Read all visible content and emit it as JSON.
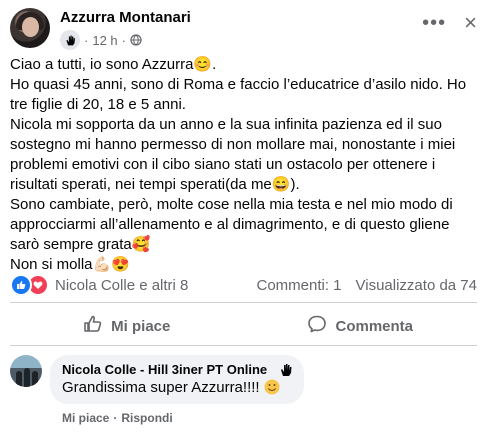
{
  "post": {
    "author": "Azzurra Montanari",
    "time": "12 h",
    "meta_separator": "·",
    "paragraphs": [
      "Ciao a tutti, io sono Azzurra😊.",
      "Ho quasi 45 anni, sono di Roma e faccio l’educatrice d’asilo nido. Ho tre figlie di 20, 18 e 5 anni.",
      "Nicola mi sopporta da un anno e la sua infinita pazienza ed il suo sostegno mi hanno permesso di non mollare mai, nonostante i miei problemi emotivi con il cibo siano stati un ostacolo per ottenere i risultati sperati, nei tempi sperati(da me😄).",
      "Sono cambiate, però,  molte cose nella mia testa e nel mio modo di approcciarmi all’allenamento e al dimagrimento, e di questo gliene sarò sempre grata🥰",
      "Non si molla💪🏻😍"
    ]
  },
  "reactions": {
    "summary": "Nicola Colle e altri 8",
    "comments": "Commenti: 1",
    "views": "Visualizzato da 74"
  },
  "actions": {
    "like": "Mi piace",
    "comment": "Commenta"
  },
  "comment": {
    "author": "Nicola Colle - Hill 3iner PT Online",
    "text": "Grandissima super Azzurra!!!!",
    "like": "Mi piace",
    "separator": "·",
    "reply": "Rispondi"
  },
  "colors": {
    "accent": "#1877f2",
    "heart": "#f33e58",
    "secondary_text": "#65676b"
  }
}
